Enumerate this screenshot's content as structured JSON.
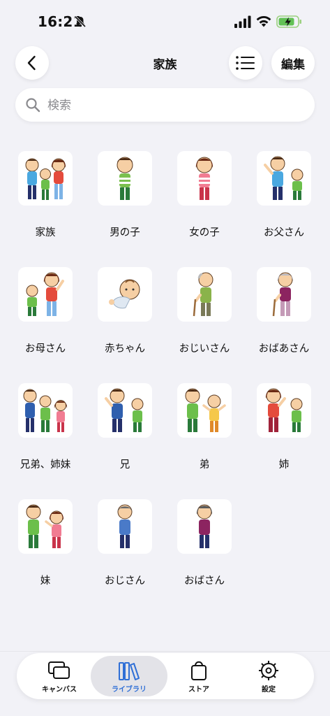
{
  "status_bar": {
    "time": "16:21",
    "icons": [
      "bell-slash-icon",
      "signal-icon",
      "wifi-icon",
      "battery-charging-icon"
    ]
  },
  "header": {
    "title": "家族",
    "back_icon": "chevron-left-icon",
    "list_icon": "list-icon",
    "edit_label": "編集"
  },
  "search": {
    "placeholder": "検索",
    "value": "",
    "icon": "search-icon"
  },
  "items": [
    {
      "label": "家族",
      "icon": "family-illustration"
    },
    {
      "label": "男の子",
      "icon": "boy-illustration"
    },
    {
      "label": "女の子",
      "icon": "girl-illustration"
    },
    {
      "label": "お父さん",
      "icon": "father-illustration"
    },
    {
      "label": "お母さん",
      "icon": "mother-illustration"
    },
    {
      "label": "赤ちゃん",
      "icon": "baby-illustration"
    },
    {
      "label": "おじいさん",
      "icon": "grandfather-illustration"
    },
    {
      "label": "おばあさん",
      "icon": "grandmother-illustration"
    },
    {
      "label": "兄弟、姉妹",
      "icon": "siblings-illustration"
    },
    {
      "label": "兄",
      "icon": "older-brother-illustration"
    },
    {
      "label": "弟",
      "icon": "younger-brother-illustration"
    },
    {
      "label": "姉",
      "icon": "older-sister-illustration"
    },
    {
      "label": "妹",
      "icon": "younger-sister-illustration"
    },
    {
      "label": "おじさん",
      "icon": "uncle-illustration"
    },
    {
      "label": "おばさん",
      "icon": "aunt-illustration"
    }
  ],
  "tabs": [
    {
      "label": "キャンバス",
      "icon": "canvas-icon",
      "selected": false
    },
    {
      "label": "ライブラリ",
      "icon": "library-icon",
      "selected": true
    },
    {
      "label": "ストア",
      "icon": "store-bag-icon",
      "selected": false
    },
    {
      "label": "設定",
      "icon": "settings-gear-icon",
      "selected": false
    }
  ],
  "colors": {
    "background": "#f2f2f7",
    "accent": "#2f6fd6",
    "card": "#ffffff"
  }
}
